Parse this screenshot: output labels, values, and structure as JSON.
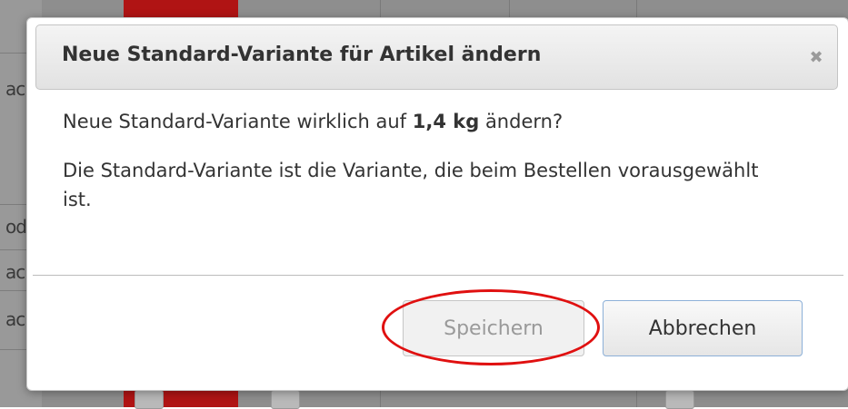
{
  "dialog": {
    "title": "Neue Standard-Variante für Artikel ändern",
    "close_icon": "✖",
    "question_prefix": "Neue Standard-Variante wirklich auf ",
    "question_value": "1,4 kg",
    "question_suffix": " ändern?",
    "info_text": "Die Standard-Variante ist die Variante, die beim Bestellen vorausgewählt ist.",
    "save_label": "Speichern",
    "cancel_label": "Abbrechen"
  },
  "background": {
    "row_fragments": [
      "ac",
      "od",
      "ac",
      "ac"
    ]
  },
  "colors": {
    "highlight": "#e01010",
    "cancel_border": "#8cb0d8",
    "tab_red": "#b01414"
  }
}
